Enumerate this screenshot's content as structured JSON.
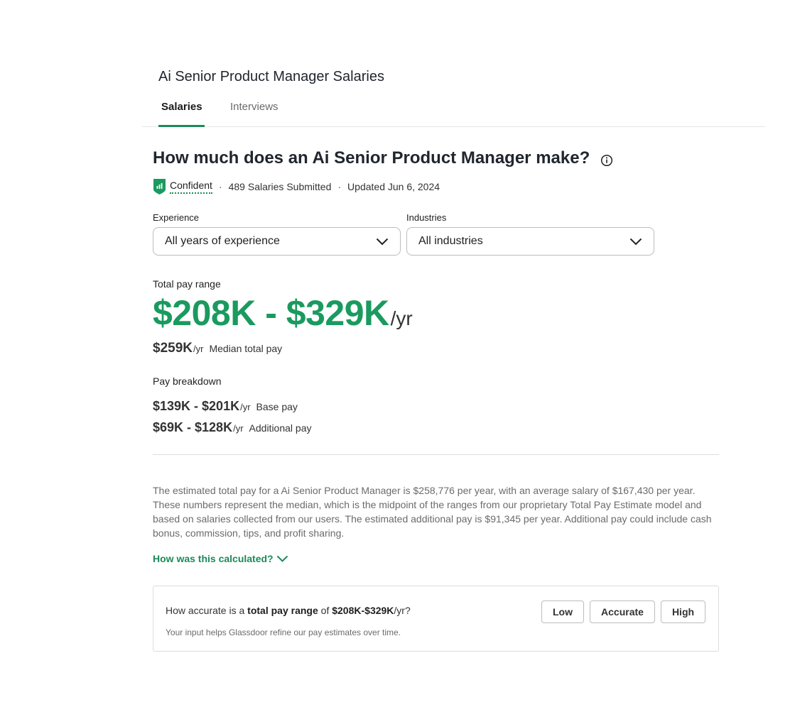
{
  "page": {
    "title": "Ai Senior Product Manager Salaries",
    "tabs": [
      {
        "label": "Salaries",
        "active": true
      },
      {
        "label": "Interviews",
        "active": false
      }
    ]
  },
  "summary": {
    "heading": "How much does an Ai Senior Product Manager make?",
    "confidence": "Confident",
    "salaries_submitted": "489 Salaries Submitted",
    "updated": "Updated Jun 6, 2024",
    "separator": "·"
  },
  "filters": {
    "experience": {
      "label": "Experience",
      "value": "All years of experience"
    },
    "industries": {
      "label": "Industries",
      "value": "All industries"
    }
  },
  "pay": {
    "total_label": "Total pay range",
    "total_range": "$208K - $329K",
    "total_unit": "/yr",
    "median_value": "$259K",
    "median_unit": "/yr",
    "median_label": "Median total pay",
    "breakdown_label": "Pay breakdown",
    "breakdown": [
      {
        "range": "$139K - $201K",
        "unit": "/yr",
        "label": "Base pay"
      },
      {
        "range": "$69K - $128K",
        "unit": "/yr",
        "label": "Additional pay"
      }
    ]
  },
  "description": "The estimated total pay for a Ai Senior Product Manager is $258,776 per year, with an average salary of $167,430 per year. These numbers represent the median, which is the midpoint of the ranges from our proprietary Total Pay Estimate model and based on salaries collected from our users. The estimated additional pay is $91,345 per year. Additional pay could include cash bonus, commission, tips, and profit sharing.",
  "calc_link": "How was this calculated?",
  "feedback": {
    "q_prefix": "How accurate is a ",
    "q_bold1": "total pay range",
    "q_mid": " of ",
    "q_bold2": "$208K-$329K",
    "q_suffix": "/yr?",
    "note": "Your input helps Glassdoor refine our pay estimates over time.",
    "buttons": {
      "low": "Low",
      "accurate": "Accurate",
      "high": "High"
    }
  },
  "colors": {
    "accent_green": "#1a9a5f",
    "link_green": "#1b8a5a",
    "muted_text": "#6b6b6b"
  },
  "icons": [
    "info-icon",
    "confidence-shield-icon",
    "chevron-down-icon"
  ]
}
